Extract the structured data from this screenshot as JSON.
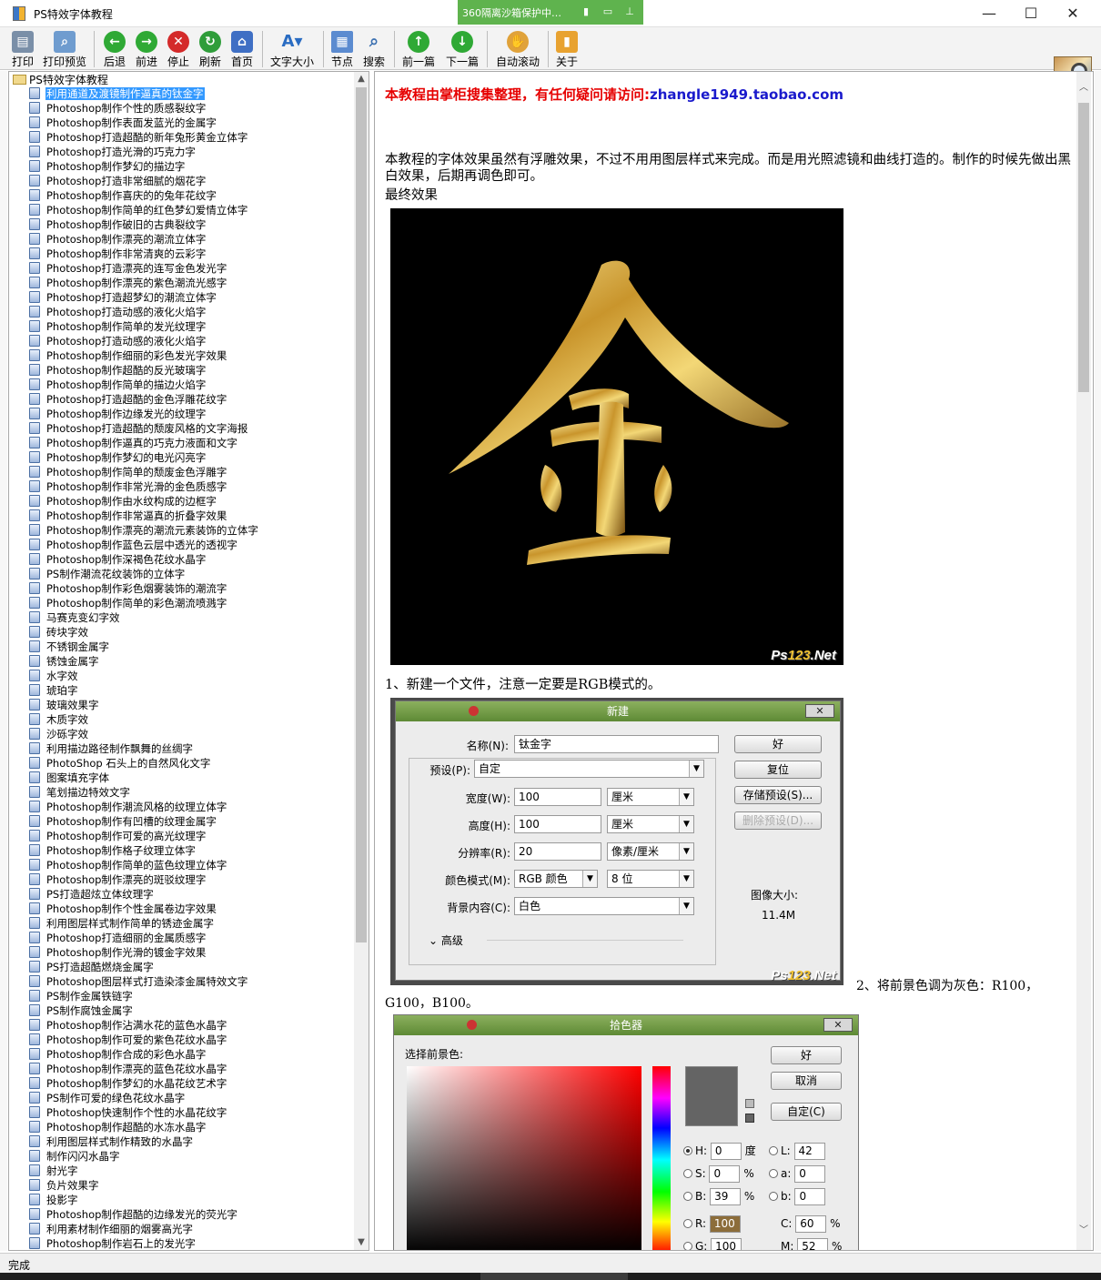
{
  "window": {
    "title": "PS特效字体教程",
    "sandbox_text": "360隔离沙箱保护中…",
    "controls": {
      "minimize": "—",
      "maximize": "☐",
      "close": "✕"
    }
  },
  "toolbar": [
    {
      "label": "打印",
      "icon": "printer-icon",
      "color": "#7a8fa8"
    },
    {
      "label": "打印预览",
      "icon": "print-preview-icon",
      "color": "#6f9ccf"
    },
    {
      "label": "后退",
      "icon": "back-icon",
      "color": "#2fa935"
    },
    {
      "label": "前进",
      "icon": "forward-icon",
      "color": "#2fa935"
    },
    {
      "label": "停止",
      "icon": "stop-icon",
      "color": "#d42a2a"
    },
    {
      "label": "刷新",
      "icon": "refresh-icon",
      "color": "#2f9d3a"
    },
    {
      "label": "首页",
      "icon": "home-icon",
      "color": "#3f6fc4"
    },
    {
      "label": "文字大小",
      "icon": "font-size-icon",
      "color": "#2a6cc2"
    },
    {
      "label": "节点",
      "icon": "node-icon",
      "color": "#5b8bd0"
    },
    {
      "label": "搜索",
      "icon": "search-icon",
      "color": "#7ba3cf"
    },
    {
      "label": "前一篇",
      "icon": "prev-article-icon",
      "color": "#2fa935"
    },
    {
      "label": "下一篇",
      "icon": "next-article-icon",
      "color": "#2fa935"
    },
    {
      "label": "自动滚动",
      "icon": "auto-scroll-icon",
      "color": "#e0a23a"
    },
    {
      "label": "关于",
      "icon": "about-icon",
      "color": "#e8a230"
    }
  ],
  "tree": {
    "root": "PS特效字体教程",
    "selected_index": 0,
    "items": [
      "利用通道及渡镜制作逼真的钛金字",
      "Photoshop制作个性的质感裂纹字",
      "Photoshop制作表面发蓝光的金属字",
      "Photoshop打造超酷的新年兔形黄金立体字",
      "Photoshop打造光滑的巧克力字",
      "Photoshop制作梦幻的描边字",
      "Photoshop打造非常细腻的烟花字",
      "Photoshop制作喜庆的的兔年花纹字",
      "Photoshop制作简单的红色梦幻爱情立体字",
      "Photoshop制作破旧的古典裂纹字",
      "Photoshop制作漂亮的潮流立体字",
      "Photoshop制作非常清爽的云彩字",
      "Photoshop打造漂亮的连写金色发光字",
      "Photoshop制作漂亮的紫色潮流光感字",
      "Photoshop打造超梦幻的潮流立体字",
      "Photoshop打造动感的液化火焰字",
      "Photoshop制作简单的发光纹理字",
      "Photoshop打造动感的液化火焰字",
      "Photoshop制作细丽的彩色发光字效果",
      "Photoshop制作超酷的反光玻璃字",
      "Photoshop制作简单的描边火焰字",
      "Photoshop打造超酷的金色浮雕花纹字",
      "Photoshop制作边缘发光的纹理字",
      "Photoshop打造超酷的颓废风格的文字海报",
      "Photoshop制作逼真的巧克力液面和文字",
      "Photoshop制作梦幻的电光闪亮字",
      "Photoshop制作简单的颓废金色浮雕字",
      "Photoshop制作非常光滑的金色质感字",
      "Photoshop制作由水纹构成的边框字",
      "Photoshop制作非常逼真的折叠字效果",
      "Photoshop制作漂亮的潮流元素装饰的立体字",
      "Photoshop制作蓝色云层中透光的透视字",
      "Photoshop制作深褐色花纹水晶字",
      "PS制作潮流花纹装饰的立体字",
      "Photoshop制作彩色烟雾装饰的潮流字",
      "Photoshop制作简单的彩色潮流喷溅字",
      "马赛克变幻字效",
      "砖块字效",
      "不锈钢金属字",
      "锈蚀金属字",
      "水字效",
      "琥珀字",
      "玻璃效果字",
      "木质字效",
      "沙砾字效",
      "利用描边路径制作飘舞的丝绸字",
      "PhotoShop 石头上的自然风化文字",
      "图案填充字体",
      "笔划描边特效文字",
      "Photoshop制作潮流风格的纹理立体字",
      "Photoshop制作有凹槽的纹理金属字",
      "Photoshop制作可爱的高光纹理字",
      "Photoshop制作格子纹理立体字",
      "Photoshop制作简单的蓝色纹理立体字",
      "Photoshop制作漂亮的斑驳纹理字",
      "PS打造超炫立体纹理字",
      "Photoshop制作个性金属卷边字效果",
      "利用图层样式制作简单的锈迹金属字",
      "Photoshop打造细丽的金属质感字",
      "Photoshop制作光滑的镀金字效果",
      "PS打造超酷燃烧金属字",
      "Photoshop图层样式打造染漆金属特效文字",
      "PS制作金属铁链字",
      "PS制作腐蚀金属字",
      "Photoshop制作沾满水花的蓝色水晶字",
      "Photoshop制作可爱的紫色花纹水晶字",
      "Photoshop制作合成的彩色水晶字",
      "Photoshop制作漂亮的蓝色花纹水晶字",
      "Photoshop制作梦幻的水晶花纹艺术字",
      "PS制作可爱的绿色花纹水晶字",
      "Photoshop快速制作个性的水晶花纹字",
      "Photoshop制作超酷的水冻水晶字",
      "利用图层样式制作精致的水晶字",
      "制作闪闪水晶字",
      "射光字",
      "负片效果字",
      "投影字",
      "Photoshop制作超酷的边缘发光的荧光字",
      "利用素材制作细丽的烟雾高光字",
      "Photoshop制作岩石上的发光字"
    ]
  },
  "article": {
    "notice_text": "本教程由掌柜搜集整理，有任何疑问请访问:",
    "notice_link": "zhangle1949.taobao.com",
    "intro": "本教程的字体效果虽然有浮雕效果，不过不用用图层样式来完成。而是用光照滤镜和曲线打造的。制作的时候先做出黑白效果，后期再调色即可。",
    "final_label": "最终效果",
    "hero_char": "金",
    "watermark_main": "Ps",
    "watermark_hl": "123",
    "watermark_tail": ".Net",
    "step1": "1、新建一个文件，注意一定要是RGB模式的。",
    "step2": "2、将前景色调为灰色：R100，G100，B100。"
  },
  "new_dialog": {
    "title": "新建",
    "close": "✕",
    "name_label": "名称(N):",
    "name_value": "钛金字",
    "preset_label": "预设(P):",
    "preset_value": "自定",
    "width_label": "宽度(W):",
    "width_value": "100",
    "width_unit": "厘米",
    "height_label": "高度(H):",
    "height_value": "100",
    "height_unit": "厘米",
    "res_label": "分辨率(R):",
    "res_value": "20",
    "res_unit": "像素/厘米",
    "mode_label": "颜色模式(M):",
    "mode_value": "RGB 颜色",
    "depth_value": "8 位",
    "bg_label": "背景内容(C):",
    "bg_value": "白色",
    "advanced": "高级",
    "ok": "好",
    "reset": "复位",
    "save_preset": "存储预设(S)...",
    "delete_preset": "删除预设(D)...",
    "size_label": "图像大小:",
    "size_value": "11.4M"
  },
  "color_picker": {
    "title": "拾色器",
    "close": "✕",
    "label": "选择前景色:",
    "ok": "好",
    "cancel": "取消",
    "custom": "自定(C)",
    "h": "0",
    "h_unit": "度",
    "s": "0",
    "s_unit": "%",
    "b": "39",
    "b_unit": "%",
    "r": "100",
    "g": "100",
    "l": "42",
    "a": "0",
    "bb": "0",
    "c": "60",
    "c_unit": "%",
    "m": "52",
    "m_unit": "%"
  },
  "status": "完成"
}
